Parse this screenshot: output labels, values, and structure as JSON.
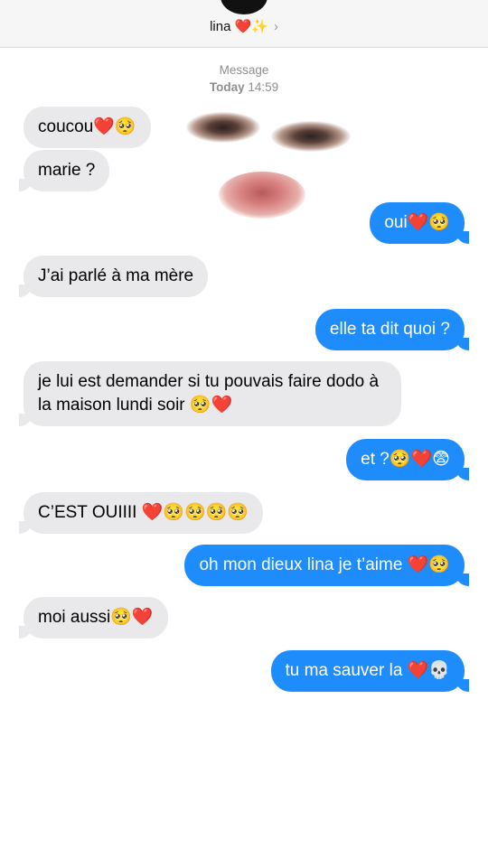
{
  "header": {
    "contact_name": "lina ❤️✨",
    "chevron": "›"
  },
  "meta": {
    "service": "Message",
    "day": "Today",
    "time": "14:59"
  },
  "messages": [
    {
      "dir": "in",
      "text": "coucou❤️🥺"
    },
    {
      "dir": "in",
      "text": "marie ?"
    },
    {
      "dir": "out",
      "text": "oui❤️🥺"
    },
    {
      "dir": "in",
      "text": "J’ai parlé à ma mère"
    },
    {
      "dir": "out",
      "text": "elle ta dit quoi ?"
    },
    {
      "dir": "in",
      "text": "je lui est demander si tu pouvais faire dodo à la maison lundi soir 🥺❤️"
    },
    {
      "dir": "out",
      "text": "et ?🥺❤️😨"
    },
    {
      "dir": "in",
      "text": "C’EST OUIIII ❤️🥺🥺🥺🥺"
    },
    {
      "dir": "out",
      "text": "oh mon dieux lina je t’aime ❤️🥺"
    },
    {
      "dir": "in",
      "text": "moi aussi🥺❤️"
    },
    {
      "dir": "out",
      "text": "tu ma sauver la ❤️💀"
    }
  ],
  "colors": {
    "incoming_bubble": "#e9e9eb",
    "outgoing_bubble": "#1e8cfb",
    "meta_text": "#8e8e93"
  }
}
